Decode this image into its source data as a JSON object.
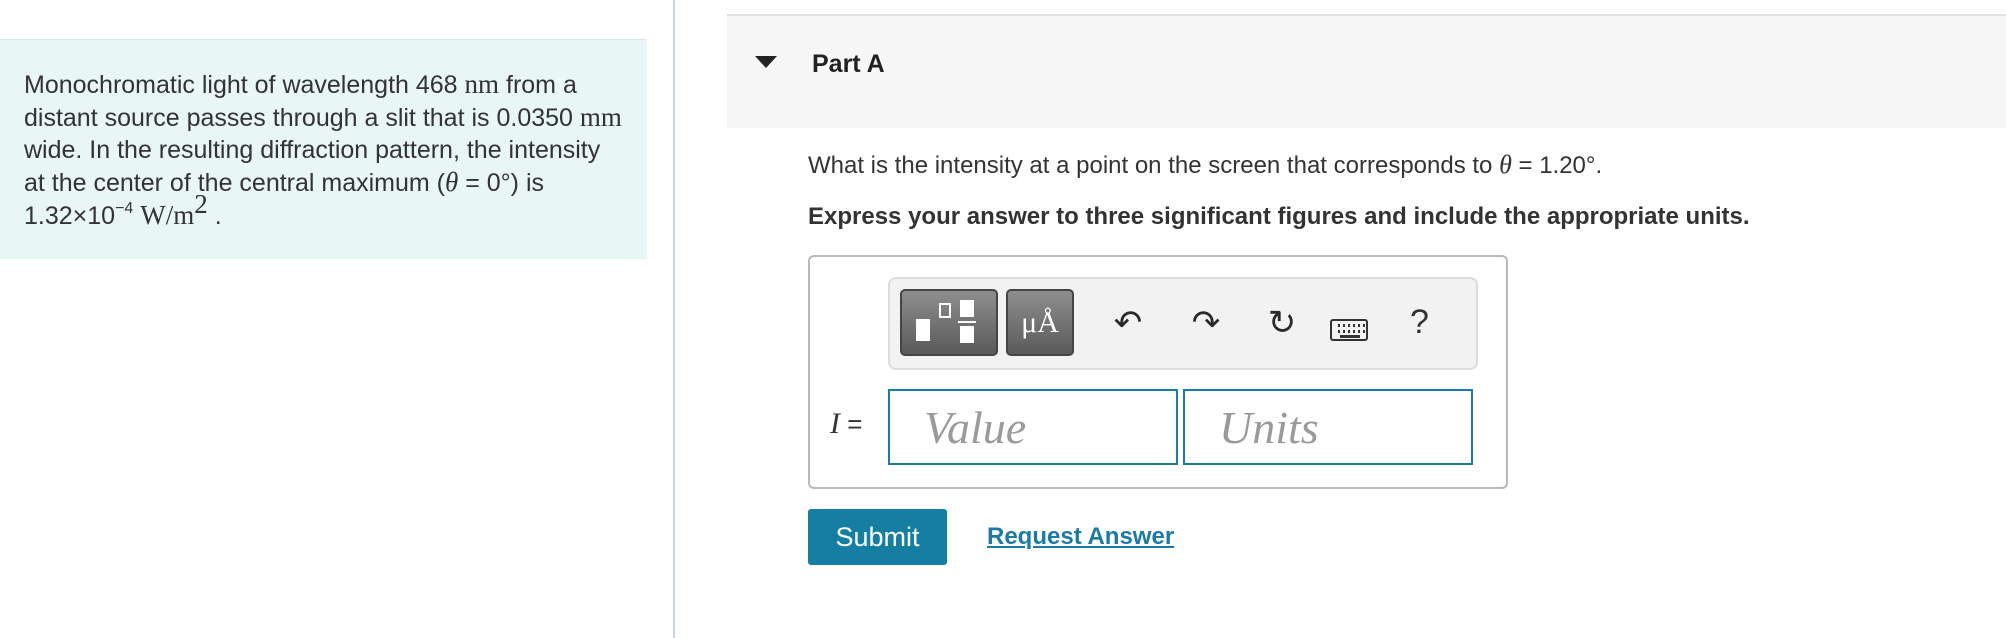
{
  "problem": {
    "text_1": "Monochromatic light of wavelength 468 ",
    "unit_nm": "nm",
    "text_2": " from a distant source passes through a slit that is 0.0350 ",
    "unit_mm": "mm",
    "text_3": " wide. In the resulting diffraction pattern, the intensity at the center of the central maximum (",
    "theta": "θ",
    "text_4": " = 0°) is 1.32×10",
    "exponent": "−4",
    "unit_w": "W/m",
    "unit_exp": "2",
    "text_end": " ."
  },
  "part": {
    "title": "Part A"
  },
  "question": {
    "text": "What is the intensity at a point on the screen that corresponds to ",
    "theta": "θ",
    "value": " = 1.20°.",
    "instruction": "Express your answer to three significant figures and include the appropriate units."
  },
  "toolbar": {
    "units_label": "μÅ",
    "undo_icon": "↶",
    "redo_icon": "↷",
    "reset_icon": "↻",
    "help_label": "?"
  },
  "answer": {
    "variable": "I",
    "equals": " =",
    "value_placeholder": "Value",
    "units_placeholder": "Units"
  },
  "actions": {
    "submit_label": "Submit",
    "request_label": "Request Answer"
  }
}
